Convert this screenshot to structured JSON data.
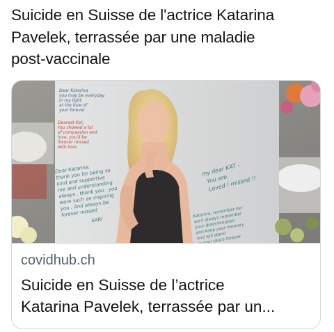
{
  "post": {
    "text_lines": [
      "Suicide en Suisse de l'actrice Katarina",
      "Pavelek, terrassée par une maladie",
      "post-vaccinale"
    ]
  },
  "link_card": {
    "domain": "covidhub.ch",
    "title_lines": [
      "Suicide en Suisse de l’actrice",
      "Katarina Pavelek, terrassée par un..."
    ]
  },
  "image": {
    "poster_notes": {
      "left_top": [
        "Dear Katarina",
        "you may be everyday",
        "in my light",
        "at the love of",
        "your forever"
      ],
      "left_mid": [
        "Dearest Kat,",
        "You showed a lot",
        "of compassion and",
        "love, you'll be",
        "forever missed",
        "with love"
      ],
      "left_bottom": [
        "Dear Katarina,",
        "thank you for being so",
        "kind and supportive",
        "me and understanding",
        "always . thank you . you",
        "were such an inspiring",
        "you . And always be",
        "forever missed",
        "SARI"
      ],
      "right_top": [
        "my dear KAT -",
        "You are",
        "Loved ! missed !!"
      ],
      "right_bottom": [
        "Katarina, remember her",
        "we'll always remember",
        "your determination",
        "and keep your memory",
        "and will stand",
        "in your place forever"
      ]
    },
    "colors": {
      "poster_bg": "#d9dadb",
      "hair": "#e8cf8f",
      "skin": "#e9b99e",
      "dress": "#2e2b2c",
      "note_ink_green": "#3f7d78",
      "note_ink_red": "#c24a3c",
      "flowers_pink": "#e6a2b8",
      "flowers_orange": "#e07a3c"
    }
  }
}
